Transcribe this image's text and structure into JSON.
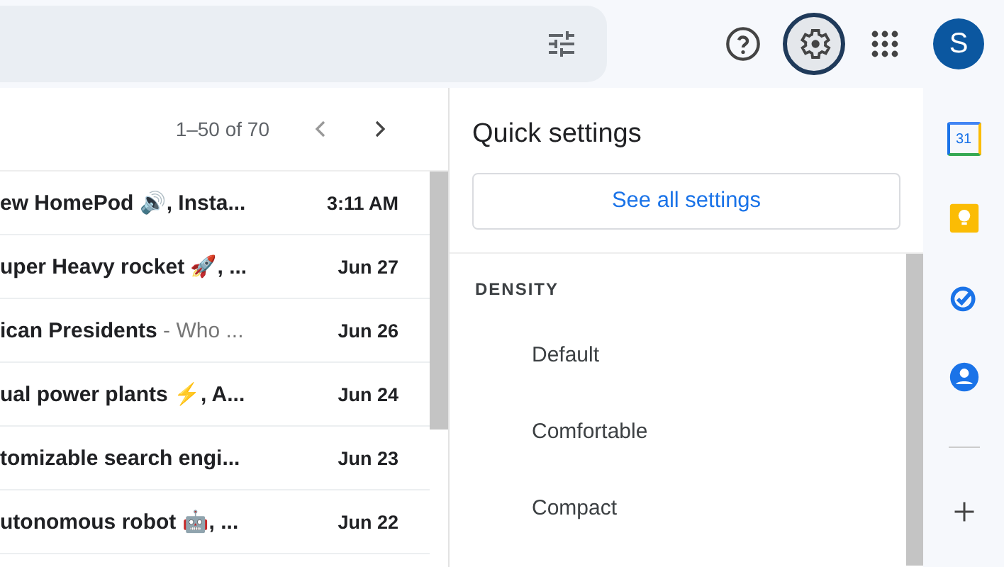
{
  "top_bar": {
    "actions": [
      {
        "kind": "help",
        "selected": false
      },
      {
        "kind": "settings",
        "selected": true
      },
      {
        "kind": "apps",
        "selected": false
      }
    ],
    "avatar": "S"
  },
  "mail_list": {
    "range": "1–50 of 70",
    "rows": [
      {
        "subject": "ew HomePod 🔊, Insta...",
        "snippet": "",
        "time": "3:11 AM"
      },
      {
        "subject": "uper Heavy rocket 🚀, ...",
        "snippet": "",
        "time": "Jun 27"
      },
      {
        "subject": "ican Presidents",
        "snippet": " - Who ...",
        "time": "Jun 26"
      },
      {
        "subject": "ual power plants ⚡, A...",
        "snippet": "",
        "time": "Jun 24"
      },
      {
        "subject": "tomizable search engi...",
        "snippet": "",
        "time": "Jun 23"
      },
      {
        "subject": "utonomous robot 🤖, ...",
        "snippet": "",
        "time": "Jun 22"
      }
    ]
  },
  "quick_settings": {
    "title": "Quick settings",
    "button": "See all settings",
    "section": "DENSITY",
    "options": [
      "Default",
      "Comfortable",
      "Compact"
    ]
  },
  "side_rail": {
    "calendar_day": "31",
    "apps": [
      {
        "kind": "calendar"
      },
      {
        "kind": "keep"
      },
      {
        "kind": "tasks"
      },
      {
        "kind": "contacts"
      }
    ]
  }
}
